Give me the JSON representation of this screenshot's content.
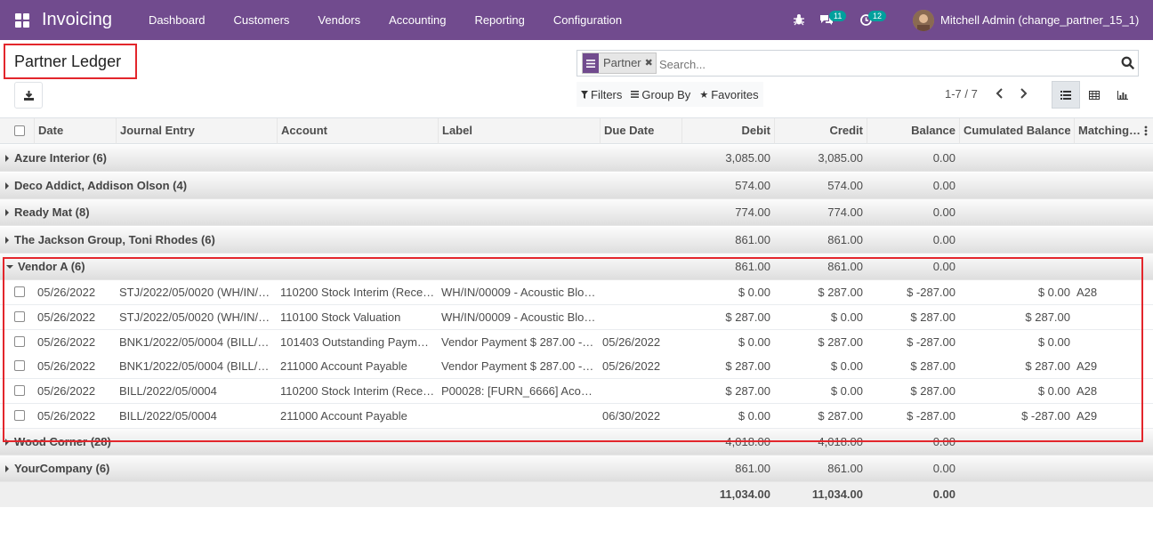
{
  "navbar": {
    "app_name": "Invoicing",
    "menu": [
      "Dashboard",
      "Customers",
      "Vendors",
      "Accounting",
      "Reporting",
      "Configuration"
    ],
    "chat_badge": "11",
    "activity_badge": "12",
    "user": "Mitchell Admin (change_partner_15_1)",
    "accent": "#714b8e"
  },
  "control": {
    "title": "Partner Ledger",
    "facet_label": "Partner",
    "search_placeholder": "Search...",
    "filters": "Filters",
    "group_by": "Group By",
    "favorites": "Favorites",
    "pager": "1-7 / 7"
  },
  "columns": [
    "Date",
    "Journal Entry",
    "Account",
    "Label",
    "Due Date",
    "Debit",
    "Credit",
    "Balance",
    "Cumulated Balance",
    "Matching…"
  ],
  "groups_before": [
    {
      "name": "Azure Interior (6)",
      "debit": "3,085.00",
      "credit": "3,085.00",
      "balance": "0.00"
    },
    {
      "name": "Deco Addict, Addison Olson (4)",
      "debit": "574.00",
      "credit": "574.00",
      "balance": "0.00"
    },
    {
      "name": "Ready Mat (8)",
      "debit": "774.00",
      "credit": "774.00",
      "balance": "0.00"
    },
    {
      "name": "The Jackson Group, Toni Rhodes (6)",
      "debit": "861.00",
      "credit": "861.00",
      "balance": "0.00"
    }
  ],
  "open_group": {
    "name": "Vendor A (6)",
    "debit": "861.00",
    "credit": "861.00",
    "balance": "0.00"
  },
  "lines": [
    {
      "date": "05/26/2022",
      "entry": "STJ/2022/05/0020 (WH/IN/…",
      "account": "110200 Stock Interim (Rece…",
      "label": "WH/IN/00009 - Acoustic Blo…",
      "due": "",
      "debit": "$ 0.00",
      "credit": "$ 287.00",
      "balance": "$ -287.00",
      "cumul": "$ 0.00",
      "match": "A28"
    },
    {
      "date": "05/26/2022",
      "entry": "STJ/2022/05/0020 (WH/IN/…",
      "account": "110100 Stock Valuation",
      "label": "WH/IN/00009 - Acoustic Blo…",
      "due": "",
      "debit": "$ 287.00",
      "credit": "$ 0.00",
      "balance": "$ 287.00",
      "cumul": "$ 287.00",
      "match": ""
    },
    {
      "date": "05/26/2022",
      "entry": "BNK1/2022/05/0004 (BILL/…",
      "account": "101403 Outstanding Paym…",
      "label": "Vendor Payment $ 287.00 -…",
      "due": "05/26/2022",
      "debit": "$ 0.00",
      "credit": "$ 287.00",
      "balance": "$ -287.00",
      "cumul": "$ 0.00",
      "match": ""
    },
    {
      "date": "05/26/2022",
      "entry": "BNK1/2022/05/0004 (BILL/…",
      "account": "211000 Account Payable",
      "label": "Vendor Payment $ 287.00 -…",
      "due": "05/26/2022",
      "debit": "$ 287.00",
      "credit": "$ 0.00",
      "balance": "$ 287.00",
      "cumul": "$ 287.00",
      "match": "A29"
    },
    {
      "date": "05/26/2022",
      "entry": "BILL/2022/05/0004",
      "account": "110200 Stock Interim (Rece…",
      "label": "P00028: [FURN_6666] Aco…",
      "due": "",
      "debit": "$ 287.00",
      "credit": "$ 0.00",
      "balance": "$ 287.00",
      "cumul": "$ 0.00",
      "match": "A28"
    },
    {
      "date": "05/26/2022",
      "entry": "BILL/2022/05/0004",
      "account": "211000 Account Payable",
      "label": "",
      "due": "06/30/2022",
      "debit": "$ 0.00",
      "credit": "$ 287.00",
      "balance": "$ -287.00",
      "cumul": "$ -287.00",
      "match": "A29"
    }
  ],
  "groups_after": [
    {
      "name": "Wood Corner (28)",
      "debit": "4,018.00",
      "credit": "4,018.00",
      "balance": "0.00"
    },
    {
      "name": "YourCompany (6)",
      "debit": "861.00",
      "credit": "861.00",
      "balance": "0.00"
    }
  ],
  "totals": {
    "debit": "11,034.00",
    "credit": "11,034.00",
    "balance": "0.00"
  }
}
